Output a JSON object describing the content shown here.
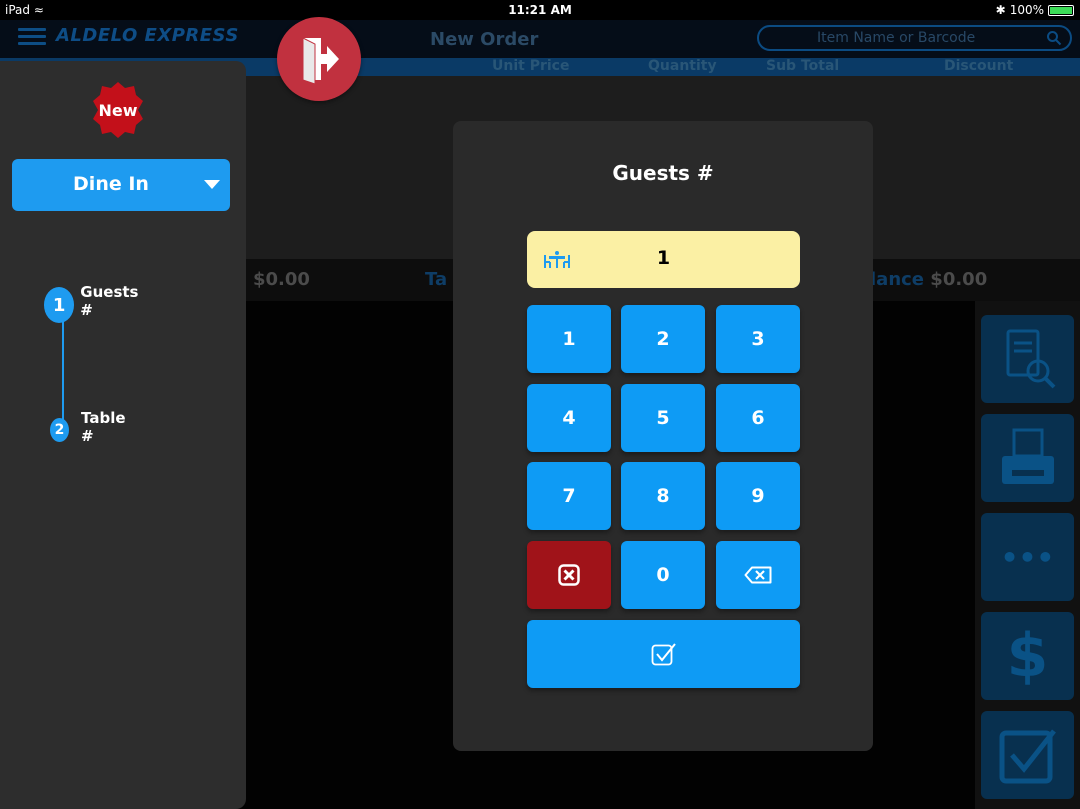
{
  "status_bar": {
    "device": "iPad",
    "time": "11:21 AM",
    "battery": "100%"
  },
  "app": {
    "brand": "ALDELO EXPRESS",
    "title": "New Order",
    "search_placeholder": "Item Name or Barcode",
    "columns": [
      "Unit Price",
      "Quantity",
      "Sub Total",
      "Discount"
    ],
    "totals": {
      "paid": "$0.00",
      "tax_partial": "Ta",
      "balance_label": "lance",
      "balance": "$0.00"
    }
  },
  "side_panel": {
    "badge": "New",
    "order_type": "Dine In",
    "steps": [
      {
        "num": "1",
        "label": "Guests #"
      },
      {
        "num": "2",
        "label": "Table #"
      }
    ]
  },
  "modal": {
    "title": "Guests #",
    "value": "1",
    "keys": [
      "1",
      "2",
      "3",
      "4",
      "5",
      "6",
      "7",
      "8",
      "9",
      "0"
    ]
  },
  "colors": {
    "accent": "#1e9bf0",
    "cancel": "#a01319",
    "display": "#fbf0a4",
    "exit": "#c1313f"
  }
}
